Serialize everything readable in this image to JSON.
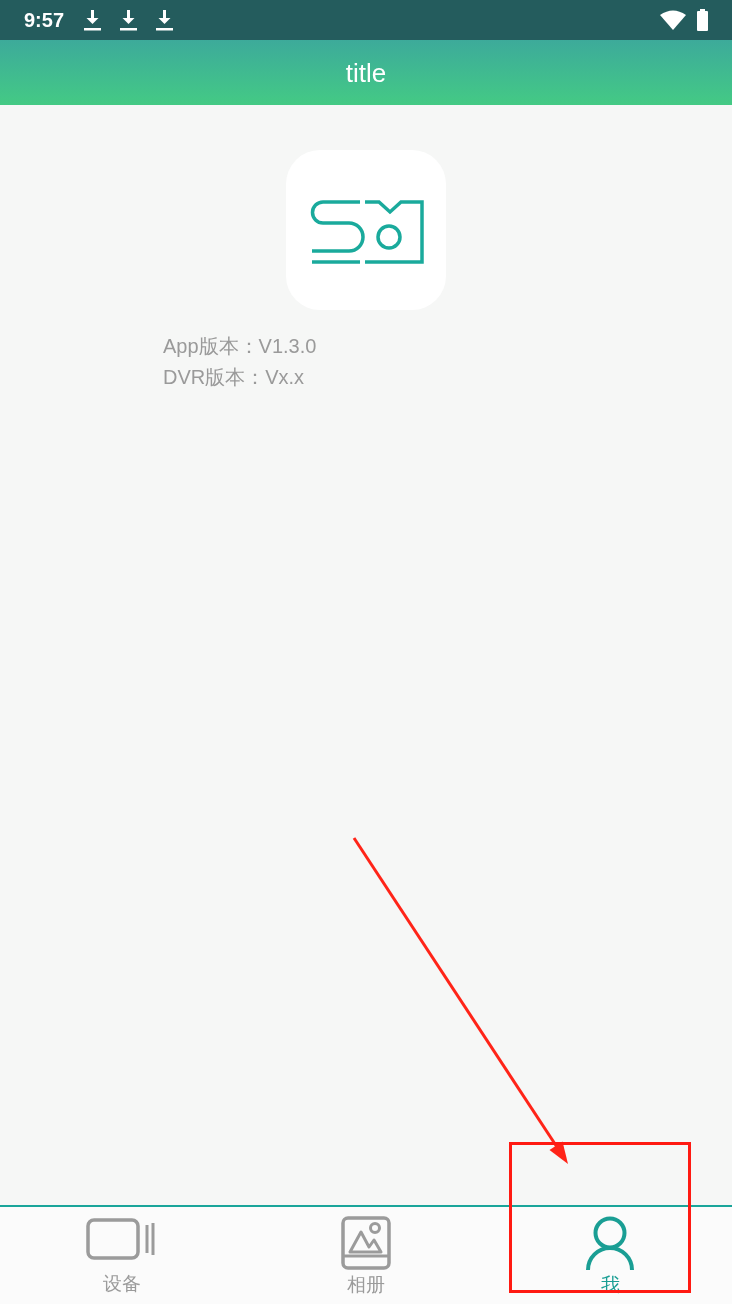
{
  "status_bar": {
    "time": "9:57"
  },
  "header": {
    "title": "title"
  },
  "about": {
    "lines": [
      "App版本：V1.3.0",
      "DVR版本：Vx.x"
    ]
  },
  "tab_bar": {
    "tabs": [
      {
        "label": "设备",
        "selected": false
      },
      {
        "label": "相册",
        "selected": false
      },
      {
        "label": "我",
        "selected": true
      }
    ]
  },
  "annotations": [
    {
      "kind": "arrow"
    },
    {
      "kind": "box"
    }
  ]
}
